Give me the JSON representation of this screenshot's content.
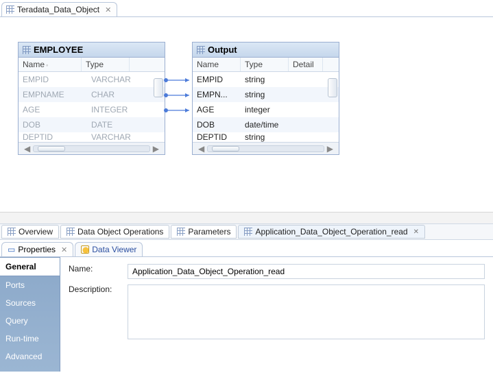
{
  "editorTab": {
    "title": "Teradata_Data_Object"
  },
  "employeePanel": {
    "title": "EMPLOYEE",
    "columns": {
      "name": "Name",
      "type": "Type"
    },
    "rows": [
      {
        "name": "EMPID",
        "type": "VARCHAR"
      },
      {
        "name": "EMPNAME",
        "type": "CHAR"
      },
      {
        "name": "AGE",
        "type": "INTEGER"
      },
      {
        "name": "DOB",
        "type": "DATE"
      },
      {
        "name": "DEPTID",
        "type": "VARCHAR"
      }
    ]
  },
  "outputPanel": {
    "title": "Output",
    "columns": {
      "name": "Name",
      "type": "Type",
      "detail": "Detail"
    },
    "rows": [
      {
        "name": "EMPID",
        "type": "string"
      },
      {
        "name": "EMPN...",
        "type": "string"
      },
      {
        "name": "AGE",
        "type": "integer"
      },
      {
        "name": "DOB",
        "type": "date/time"
      },
      {
        "name": "DEPTID",
        "type": "string"
      }
    ]
  },
  "canvasTabs": {
    "overview": "Overview",
    "dataObjectOps": "Data Object Operations",
    "parameters": "Parameters",
    "appRead": "Application_Data_Object_Operation_read"
  },
  "viewTabs": {
    "properties": "Properties",
    "dataViewer": "Data Viewer"
  },
  "propsSidebar": {
    "general": "General",
    "ports": "Ports",
    "sources": "Sources",
    "query": "Query",
    "runtime": "Run-time",
    "advanced": "Advanced"
  },
  "props": {
    "nameLabel": "Name:",
    "descLabel": "Description:",
    "nameValue": "Application_Data_Object_Operation_read",
    "descValue": ""
  }
}
